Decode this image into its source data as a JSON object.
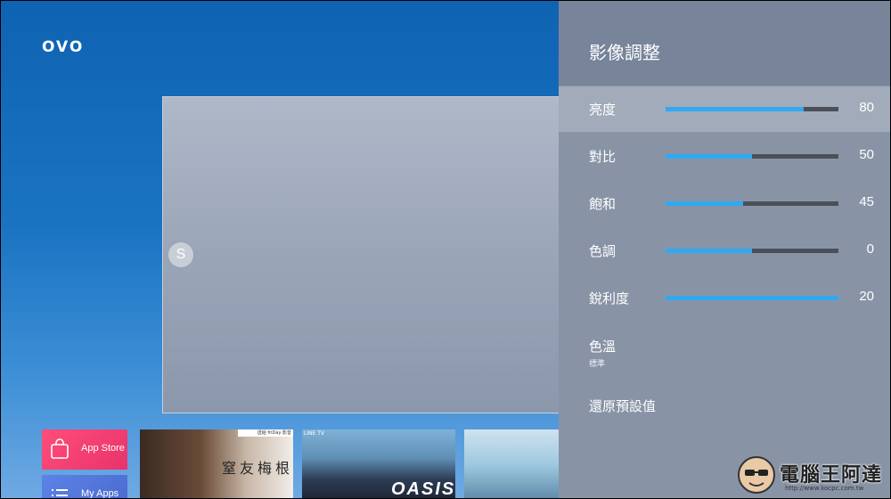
{
  "launcher": {
    "logo": "OVO",
    "preview_badge": "S",
    "tiles": {
      "app_store": "App Store",
      "my_apps": "My Apps"
    },
    "posters": [
      {
        "title": "窒友梅根",
        "banner": "送給 friDay 影音"
      },
      {
        "title": "OASIS",
        "banner": "LINE TV"
      },
      {
        "title": ""
      }
    ]
  },
  "settings_panel": {
    "title": "影像調整",
    "sliders": [
      {
        "label": "亮度",
        "value": 80,
        "display": "80",
        "fill_fraction": 0.8
      },
      {
        "label": "對比",
        "value": 50,
        "display": "50",
        "fill_fraction": 0.5
      },
      {
        "label": "飽和",
        "value": 45,
        "display": "45",
        "fill_fraction": 0.45
      },
      {
        "label": "色調",
        "value": 0,
        "display": "0",
        "fill_fraction": 0.5
      },
      {
        "label": "銳利度",
        "value": 20,
        "display": "20",
        "fill_fraction": 1.0
      }
    ],
    "color_temp": {
      "label": "色溫",
      "value": "標準"
    },
    "reset_label": "還原預設值"
  },
  "watermark": {
    "text": "電腦王阿達",
    "url": "http://www.kocpc.com.tw"
  },
  "colors": {
    "accent": "#31a9f2",
    "panel_bg": "#8894a6",
    "selected_row": "#a2abba",
    "track": "#4b4f58"
  }
}
